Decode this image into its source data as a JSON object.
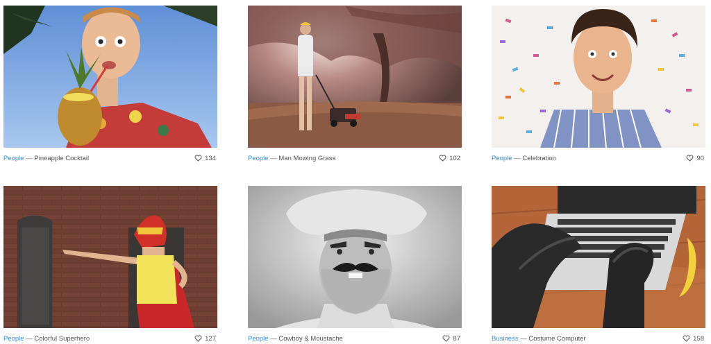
{
  "cards": [
    {
      "category": "People",
      "separator": "—",
      "title": "Pineapple Cocktail",
      "likes": "134",
      "icon": "heart-icon"
    },
    {
      "category": "People",
      "separator": "—",
      "title": "Man Mowing Grass",
      "likes": "102",
      "icon": "heart-icon"
    },
    {
      "category": "People",
      "separator": "—",
      "title": "Celebration",
      "likes": "90",
      "icon": "heart-icon"
    },
    {
      "category": "People",
      "separator": "—",
      "title": "Colorful Superhero",
      "likes": "127",
      "icon": "heart-icon"
    },
    {
      "category": "People",
      "separator": "—",
      "title": "Cowboy & Moustache",
      "likes": "87",
      "icon": "heart-icon"
    },
    {
      "category": "Business",
      "separator": "—",
      "title": "Costume Computer",
      "likes": "158",
      "icon": "heart-icon"
    }
  ],
  "colors": {
    "category_link": "#3a8fcf",
    "text": "#555555"
  }
}
